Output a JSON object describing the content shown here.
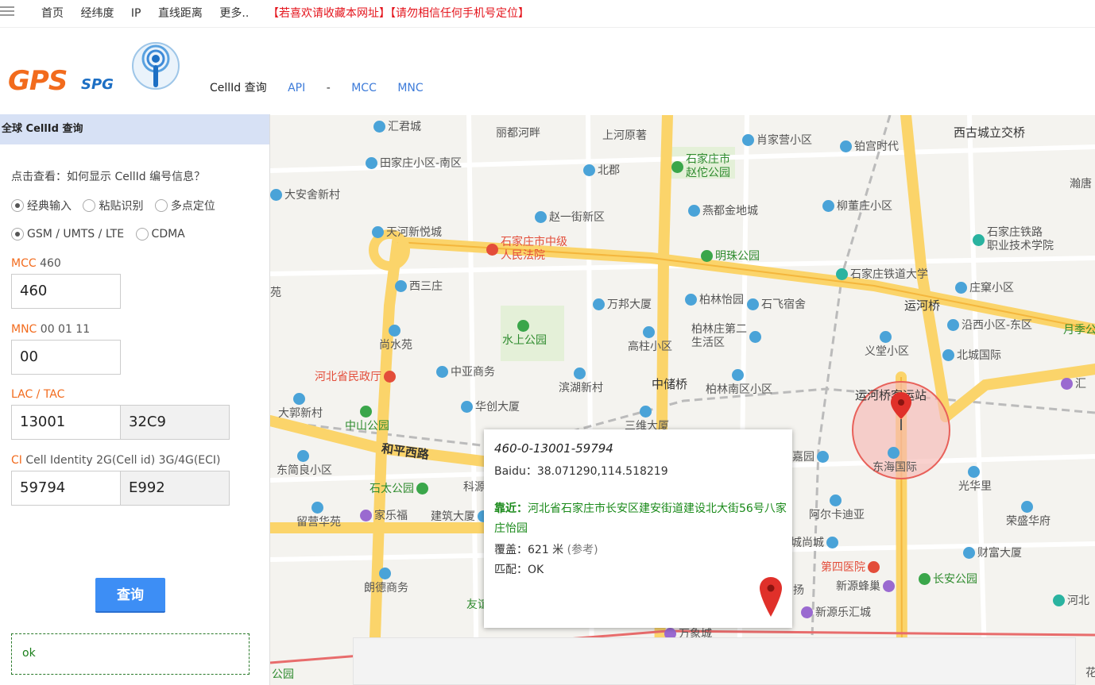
{
  "top_nav": {
    "links": [
      "首页",
      "经纬度",
      "IP",
      "直线距离",
      "更多.."
    ],
    "notice": "【若喜欢请收藏本网址】【请勿相信任何手机号定位】"
  },
  "logo": {
    "gps": "GPS",
    "spg": "SPG"
  },
  "sub_nav": {
    "current": "CellId 查询",
    "api": "API",
    "sep": "-",
    "mcc": "MCC",
    "mnc": "MNC"
  },
  "panel": {
    "title": "全球 CellId 查询",
    "help": "点击查看：如何显示 CellId 编号信息？",
    "input_modes": [
      {
        "label": "经典输入",
        "checked": true
      },
      {
        "label": "粘贴识别",
        "checked": false
      },
      {
        "label": "多点定位",
        "checked": false
      }
    ],
    "networks": [
      {
        "label": "GSM / UMTS / LTE",
        "checked": true
      },
      {
        "label": "CDMA",
        "checked": false
      }
    ],
    "mcc": {
      "key": "MCC",
      "hint": "460",
      "value": "460"
    },
    "mnc": {
      "key": "MNC",
      "hint": "00 01 11",
      "value": "00"
    },
    "lac": {
      "key": "LAC / TAC",
      "hint": "",
      "value": "13001",
      "hex": "32C9"
    },
    "ci": {
      "key": "CI",
      "hint": "Cell Identity 2G(Cell id) 3G/4G(ECI)",
      "value": "59794",
      "hex": "E992"
    },
    "query_button": "查询",
    "result": "ok"
  },
  "map": {
    "pois": [
      {
        "text": "汇君城",
        "type": "poi"
      },
      {
        "text": "丽都河畔",
        "type": "poi"
      },
      {
        "text": "上河原著",
        "type": "poi"
      },
      {
        "text": "肖家营小区",
        "type": "poi"
      },
      {
        "text": "铂宫时代",
        "type": "poi"
      },
      {
        "text": "西古城立交桥",
        "type": "road"
      },
      {
        "text": "田家庄小区-南区",
        "type": "poi"
      },
      {
        "text": "北郡",
        "type": "poi"
      },
      {
        "text": "石家庄市\n赵佗公园",
        "type": "park"
      },
      {
        "text": "大安舍新村",
        "type": "poi"
      },
      {
        "text": "燕都金地城",
        "type": "poi"
      },
      {
        "text": "柳董庄小区",
        "type": "poi"
      },
      {
        "text": "瀚唐",
        "type": "poi"
      },
      {
        "text": "赵一街新区",
        "type": "poi"
      },
      {
        "text": "天河新悦城",
        "type": "poi"
      },
      {
        "text": "石家庄铁路\n职业技术学院",
        "type": "poi"
      },
      {
        "text": "石家庄市中级\n人民法院",
        "type": "red"
      },
      {
        "text": "明珠公园",
        "type": "park"
      },
      {
        "text": "石家庄铁道大学",
        "type": "poi"
      },
      {
        "text": "庄窠小区",
        "type": "poi"
      },
      {
        "text": "西三庄",
        "type": "poi"
      },
      {
        "text": "万邦大厦",
        "type": "poi"
      },
      {
        "text": "柏林怡园",
        "type": "poi"
      },
      {
        "text": "石飞宿舍",
        "type": "poi"
      },
      {
        "text": "运河桥",
        "type": "road"
      },
      {
        "text": "沿西小区-东区",
        "type": "poi"
      },
      {
        "text": "月季公",
        "type": "park"
      },
      {
        "text": "尚水苑",
        "type": "poi"
      },
      {
        "text": "水上公园",
        "type": "park"
      },
      {
        "text": "高柱小区",
        "type": "poi"
      },
      {
        "text": "柏林庄第二\n生活区",
        "type": "poi"
      },
      {
        "text": "义堂小区",
        "type": "poi"
      },
      {
        "text": "北城国际",
        "type": "poi"
      },
      {
        "text": "河北省民政厅",
        "type": "red"
      },
      {
        "text": "中亚商务",
        "type": "poi"
      },
      {
        "text": "中储桥",
        "type": "road"
      },
      {
        "text": "滨湖新村",
        "type": "poi"
      },
      {
        "text": "柏林南区小区",
        "type": "poi"
      },
      {
        "text": "运河桥客运站",
        "type": "road"
      },
      {
        "text": "汇",
        "type": "purple"
      },
      {
        "text": "大郭新村",
        "type": "poi"
      },
      {
        "text": "华创大厦",
        "type": "poi"
      },
      {
        "text": "中山公园",
        "type": "park"
      },
      {
        "text": "三维大厦",
        "type": "poi"
      },
      {
        "text": "和平西路",
        "type": "road"
      },
      {
        "text": "嘉园",
        "type": "poi"
      },
      {
        "text": "东海国际",
        "type": "poi"
      },
      {
        "text": "东简良小区",
        "type": "poi"
      },
      {
        "text": "石太公园",
        "type": "park"
      },
      {
        "text": "科源",
        "type": "poi"
      },
      {
        "text": "光华里",
        "type": "poi"
      },
      {
        "text": "家乐福",
        "type": "purple"
      },
      {
        "text": "建筑大厦",
        "type": "poi"
      },
      {
        "text": "阿尔卡迪亚",
        "type": "poi"
      },
      {
        "text": "荣盛华府",
        "type": "poi"
      },
      {
        "text": "留营华苑",
        "type": "poi"
      },
      {
        "text": "城尚城",
        "type": "poi"
      },
      {
        "text": "财富大厦",
        "type": "poi"
      },
      {
        "text": "第四医院",
        "type": "red"
      },
      {
        "text": "长安公园",
        "type": "park"
      },
      {
        "text": "朗德商务",
        "type": "poi"
      },
      {
        "text": "新源蜂巢",
        "type": "purple"
      },
      {
        "text": "河北",
        "type": "poi"
      },
      {
        "text": "友谊",
        "type": "park"
      },
      {
        "text": "新源乐汇城",
        "type": "purple"
      },
      {
        "text": "万象城",
        "type": "purple"
      },
      {
        "text": "公园",
        "type": "park"
      },
      {
        "text": "花",
        "type": "poi"
      },
      {
        "text": "苑",
        "type": "poi"
      },
      {
        "text": "扬",
        "type": "poi"
      }
    ],
    "popup": {
      "id": "460-0-13001-59794",
      "baidu_label": "Baidu：",
      "baidu_value": "38.071290,114.518219",
      "near_label": "靠近：",
      "near_value": "河北省石家庄市长安区建安街道建设北大街56号八家庄怡园",
      "cover_label": "覆盖：",
      "cover_value": "621 米",
      "cover_ref": "(参考)",
      "match_label": "匹配：",
      "match_value": "OK"
    },
    "colors": {
      "major_road": "#fbd46a",
      "circle_fill": "#f6b9b4",
      "circle_stroke": "#e8615a",
      "marker": "#e0302a"
    }
  }
}
